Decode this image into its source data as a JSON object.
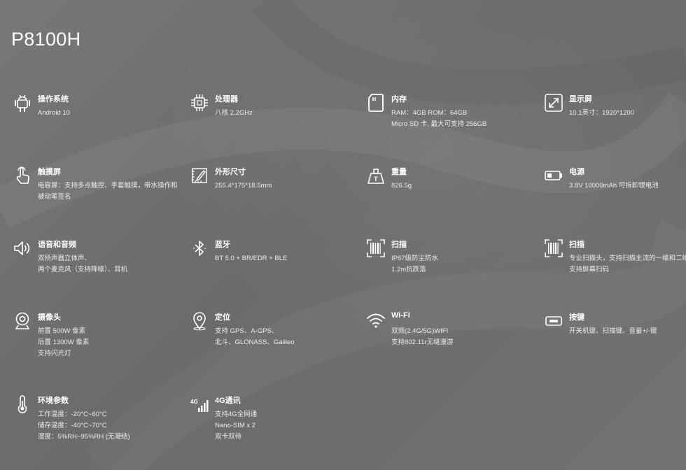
{
  "title": "P8100H",
  "specs": [
    {
      "icon": "android-icon",
      "name": "操作系统",
      "lines": [
        "Android 10"
      ]
    },
    {
      "icon": "cpu-chip-icon",
      "name": "处理器",
      "lines": [
        "八核 2.2GHz"
      ]
    },
    {
      "icon": "sd-card-icon",
      "name": "内存",
      "lines": [
        "RAM：4GB ROM：64GB",
        "Micro SD 卡, 最大可支持 256GB"
      ]
    },
    {
      "icon": "resize-arrows-icon",
      "name": "显示屏",
      "lines": [
        "10.1英寸：1920*1200"
      ]
    },
    {
      "icon": "touch-hand-icon",
      "name": "触摸屏",
      "lines": [
        "电容屏：支持多点触控、手套触摸，带水操作和被动笔签名"
      ]
    },
    {
      "icon": "ruler-pencil-icon",
      "name": "外形尺寸",
      "lines": [
        "255.4*175*18.5mm"
      ]
    },
    {
      "icon": "weight-icon",
      "name": "重量",
      "lines": [
        "826.5g"
      ]
    },
    {
      "icon": "battery-icon",
      "name": "电源",
      "lines": [
        "3.8V 10000mAh 可拆卸锂电池"
      ]
    },
    {
      "icon": "speaker-icon",
      "name": "语音和音频",
      "lines": [
        "双扬声器立体声、",
        "两个麦克风（支持降噪）、耳机"
      ]
    },
    {
      "icon": "bluetooth-icon",
      "name": "蓝牙",
      "lines": [
        "BT 5.0 + BR/EDR + BLE"
      ]
    },
    {
      "icon": "barcode-scan-icon",
      "name": "扫描",
      "lines": [
        "IP67级防尘防水",
        "1.2m抗跌落"
      ]
    },
    {
      "icon": "barcode-scan-icon",
      "name": "扫描",
      "lines": [
        "专业扫描头，支持扫描主流的一维和二维码",
        "支持屏幕扫码"
      ]
    },
    {
      "icon": "webcam-icon",
      "name": "摄像头",
      "lines": [
        "前置 500W 像素",
        "后置 1300W 像素",
        "支持闪光灯"
      ]
    },
    {
      "icon": "location-pin-icon",
      "name": "定位",
      "lines": [
        "支持 GPS、A-GPS、",
        "北斗、GLONASS、Galileo"
      ]
    },
    {
      "icon": "wifi-icon",
      "name": "Wi-Fi",
      "lines": [
        "双频(2.4G/5G)WIFI",
        "支持802.11r无缝漫游"
      ]
    },
    {
      "icon": "key-button-icon",
      "name": "按键",
      "lines": [
        "开关机键、扫描键、音量+/-键"
      ]
    },
    {
      "icon": "thermometer-icon",
      "name": "环境参数",
      "lines": [
        "工作温度：-20°C~60°C",
        "储存温度：-40°C~70°C",
        "湿度：5%RH~95%RH (无凝结)"
      ]
    },
    {
      "icon": "signal-4g-icon",
      "name": "4G通讯",
      "lines": [
        "支持4G全网通",
        "Nano-SIM x 2",
        "双卡双待"
      ],
      "icon_text": "4G"
    }
  ]
}
